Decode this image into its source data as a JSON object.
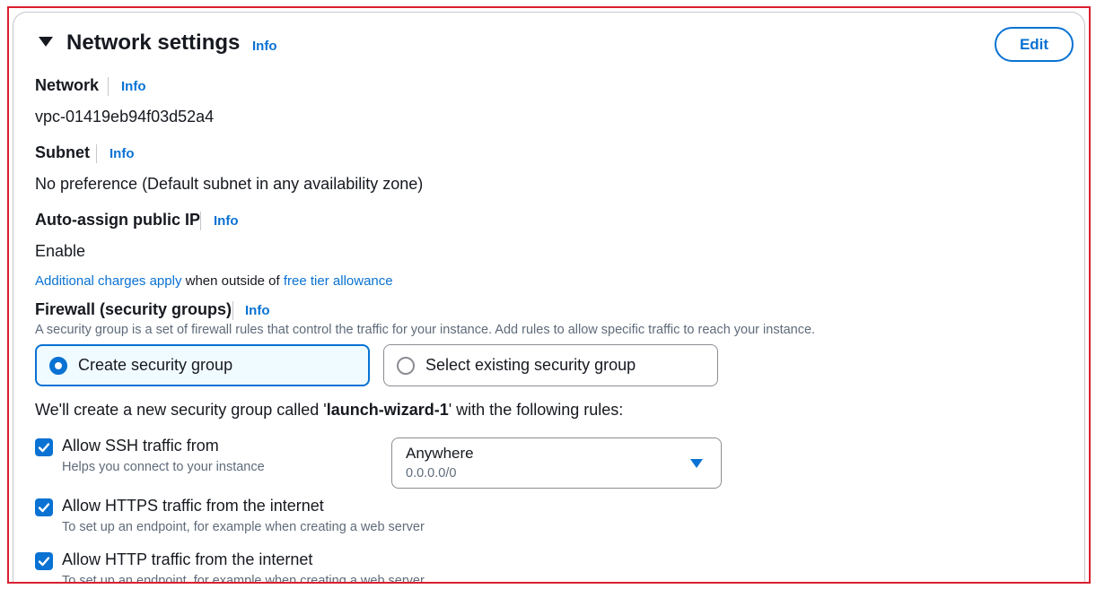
{
  "section": {
    "title": "Network settings",
    "info": "Info",
    "edit_label": "Edit"
  },
  "network": {
    "label": "Network",
    "info": "Info",
    "value": "vpc-01419eb94f03d52a4"
  },
  "subnet": {
    "label": "Subnet",
    "info": "Info",
    "value": "No preference (Default subnet in any availability zone)"
  },
  "public_ip": {
    "label": "Auto-assign public IP",
    "info": "Info",
    "value": "Enable",
    "charges_link": "Additional charges apply",
    "charges_middle": " when outside of ",
    "free_tier_link": "free tier allowance"
  },
  "firewall": {
    "label": "Firewall (security groups)",
    "info": "Info",
    "description": "A security group is a set of firewall rules that control the traffic for your instance. Add rules to allow specific traffic to reach your instance.",
    "options": [
      {
        "label": "Create security group",
        "selected": true
      },
      {
        "label": "Select existing security group",
        "selected": false
      }
    ],
    "rules_intro_prefix": "We'll create a new security group called '",
    "group_name": "launch-wizard-1",
    "rules_intro_suffix": "' with the following rules:"
  },
  "rules": [
    {
      "label": "Allow SSH traffic from",
      "hint": "Helps you connect to your instance",
      "checked": true
    },
    {
      "label": "Allow HTTPS traffic from the internet",
      "hint": "To set up an endpoint, for example when creating a web server",
      "checked": true
    },
    {
      "label": "Allow HTTP traffic from the internet",
      "hint": "To set up an endpoint, for example when creating a web server",
      "checked": true
    }
  ],
  "ssh_source": {
    "value": "Anywhere",
    "sub": "0.0.0.0/0"
  },
  "colors": {
    "accent": "#0972d3",
    "frame": "#d91f2f",
    "selected_bg": "#f0fbff"
  }
}
